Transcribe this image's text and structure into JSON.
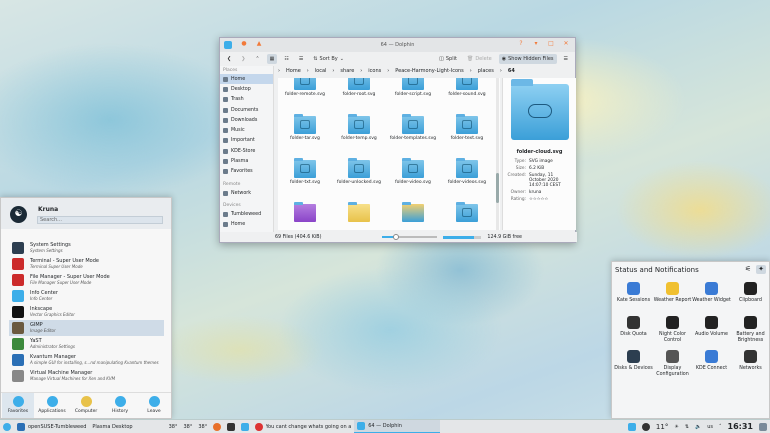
{
  "dolphin": {
    "title": "64 — Dolphin",
    "toolbar": {
      "sort_by": "Sort By",
      "split": "Split",
      "delete": "Delete",
      "show_hidden": "Show Hidden Files"
    },
    "places_header": "Places",
    "places": [
      "Home",
      "Desktop",
      "Trash",
      "Documents",
      "Downloads",
      "Music",
      "Important",
      "KDE-Store",
      "Plasma",
      "Favorites"
    ],
    "remote_header": "Remote",
    "remote": [
      "Network"
    ],
    "devices_header": "Devices",
    "devices": [
      "Tumbleweed",
      "Home"
    ],
    "breadcrumb": [
      "Home",
      "local",
      "share",
      "icons",
      "Peace-Harmony-Light-Icons",
      "places",
      "64"
    ],
    "files": [
      "folder-remote.svg",
      "folder-root.svg",
      "folder-script.svg",
      "folder-sound.svg",
      "folder-tar.svg",
      "folder-temp.svg",
      "folder-templates.svg",
      "folder-text.svg",
      "folder-txt.svg",
      "folder-unlocked.svg",
      "folder-video.svg",
      "folder-videos.svg"
    ],
    "info": {
      "name": "folder-cloud.svg",
      "type_k": "Type:",
      "type_v": "SVG image",
      "size_k": "Size:",
      "size_v": "6.2 KiB",
      "created_k": "Created:",
      "created_v": "Sunday, 11 October 2020 14:07:10 CEST",
      "owner_k": "Owner:",
      "owner_v": "kruna",
      "rating_k": "Rating:",
      "rating_v": "☆☆☆☆☆"
    },
    "status": {
      "count": "69 Files (404.6 KiB)",
      "free": "124.9 GiB free",
      "zoom_fraction": 0.25,
      "disk_fraction": 0.8
    }
  },
  "launcher": {
    "user": "Kruna",
    "search_placeholder": "Search...",
    "items": [
      {
        "title": "System Settings",
        "sub": "System Settings",
        "color": "#2d3e50"
      },
      {
        "title": "Terminal - Super User Mode",
        "sub": "Terminal Super User Mode",
        "color": "#cc2b2b"
      },
      {
        "title": "File Manager - Super User Mode",
        "sub": "File Manager Super User Mode",
        "color": "#cc2b2b"
      },
      {
        "title": "Info Center",
        "sub": "Info Center",
        "color": "#3daee9"
      },
      {
        "title": "Inkscape",
        "sub": "Vector Graphics Editor",
        "color": "#111"
      },
      {
        "title": "GIMP",
        "sub": "Image Editor",
        "color": "#6b5a40"
      },
      {
        "title": "YaST",
        "sub": "Administrator Settings",
        "color": "#3c8a3c"
      },
      {
        "title": "Kvantum Manager",
        "sub": "A simple GUI for installing, s...nd manipulating Kvantum themes",
        "color": "#2b6fb5"
      },
      {
        "title": "Virtual Machine Manager",
        "sub": "Manage Virtual Machines for Xen and KVM",
        "color": "#888"
      }
    ],
    "tabs": [
      "Favorites",
      "Applications",
      "Computer",
      "History",
      "Leave"
    ]
  },
  "notifications": {
    "title": "Status and Notifications",
    "items": [
      "Kate Sessions",
      "Weather Report",
      "Weather Widget",
      "Clipboard",
      "Disk Quota",
      "Night Color Control",
      "Audio Volume",
      "Battery and Brightness",
      "Disks & Devices",
      "Display Configuration",
      "KDE Connect",
      "Networks"
    ]
  },
  "taskbar": {
    "menu_label": "openSUSE-Tumbleweed",
    "desktop": "Plasma Desktop",
    "temps": [
      "38°",
      "38°",
      "38°"
    ],
    "task1": "You cant change whats going on ar...",
    "task2": "64 — Dolphin",
    "weather": "11°",
    "kbd": "us",
    "time": "16:31"
  }
}
